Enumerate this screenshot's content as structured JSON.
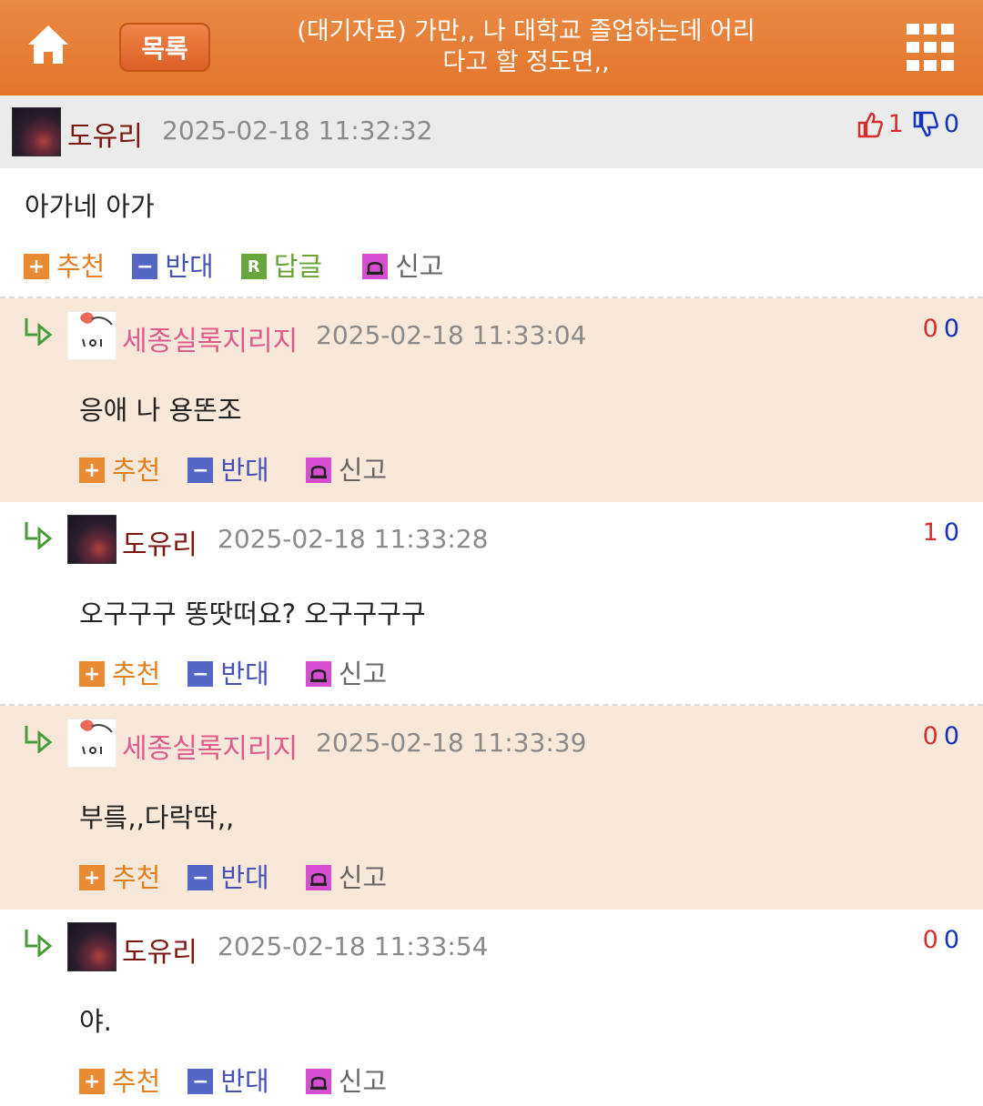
{
  "header": {
    "list_label": "목록",
    "title_line1": "(대기자료) 가만,, 나 대학교 졸업하는데 어리",
    "title_line2": "다고 할 정도면,,",
    "colors": {
      "bar": "#e57a33",
      "button": "#dc5f26"
    }
  },
  "actions": {
    "recommend": "추천",
    "oppose": "반대",
    "reply": "답글",
    "report": "신고"
  },
  "post": {
    "author": "도유리",
    "timestamp": "2025-02-18 11:32:32",
    "up": "1",
    "down": "0",
    "body": "아가네 아가"
  },
  "comments": [
    {
      "author": "세종실록지리지",
      "timestamp": "2025-02-18 11:33:04",
      "up": "0",
      "down": "0",
      "body": "응애 나 용똔조"
    },
    {
      "author": "도유리",
      "timestamp": "2025-02-18 11:33:28",
      "up": "1",
      "down": "0",
      "body": "오구구구 똥땃떠요? 오구구구구"
    },
    {
      "author": "세종실록지리지",
      "timestamp": "2025-02-18 11:33:39",
      "up": "0",
      "down": "0",
      "body": "부릌,,다락딱,,"
    },
    {
      "author": "도유리",
      "timestamp": "2025-02-18 11:33:54",
      "up": "0",
      "down": "0",
      "body": "야."
    }
  ]
}
